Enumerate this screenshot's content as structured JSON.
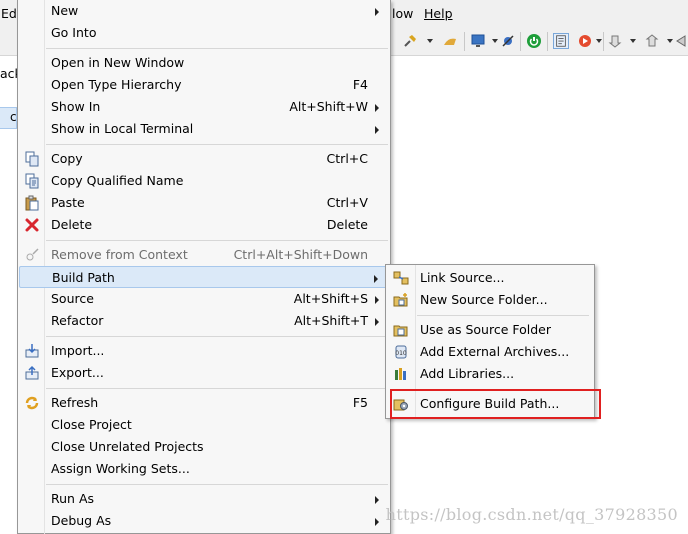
{
  "menubar": {
    "left_fragment": "Ed",
    "window_fragment": "low",
    "help": "Help"
  },
  "left_fragments": [
    "ack",
    "c"
  ],
  "context_menu": {
    "items": [
      {
        "label": "New",
        "accel": "",
        "submenu": true,
        "icon": "",
        "disabled": false
      },
      {
        "label": "Go Into",
        "accel": "",
        "submenu": false,
        "icon": "",
        "disabled": false
      },
      {
        "label": "Open in New Window",
        "accel": "",
        "submenu": false,
        "icon": "",
        "disabled": false
      },
      {
        "label": "Open Type Hierarchy",
        "accel": "F4",
        "submenu": false,
        "icon": "",
        "disabled": false
      },
      {
        "label": "Show In",
        "accel": "Alt+Shift+W",
        "submenu": true,
        "icon": "",
        "disabled": false
      },
      {
        "label": "Show in Local Terminal",
        "accel": "",
        "submenu": true,
        "icon": "",
        "disabled": false
      },
      {
        "label": "Copy",
        "accel": "Ctrl+C",
        "submenu": false,
        "icon": "copy-icon",
        "disabled": false
      },
      {
        "label": "Copy Qualified Name",
        "accel": "",
        "submenu": false,
        "icon": "copy-qualified-icon",
        "disabled": false
      },
      {
        "label": "Paste",
        "accel": "Ctrl+V",
        "submenu": false,
        "icon": "paste-icon",
        "disabled": false
      },
      {
        "label": "Delete",
        "accel": "Delete",
        "submenu": false,
        "icon": "delete-icon",
        "disabled": false
      },
      {
        "label": "Remove from Context",
        "accel": "Ctrl+Alt+Shift+Down",
        "submenu": false,
        "icon": "remove-context-icon",
        "disabled": true
      },
      {
        "label": "Build Path",
        "accel": "",
        "submenu": true,
        "icon": "",
        "disabled": false
      },
      {
        "label": "Source",
        "accel": "Alt+Shift+S",
        "submenu": true,
        "icon": "",
        "disabled": false
      },
      {
        "label": "Refactor",
        "accel": "Alt+Shift+T",
        "submenu": true,
        "icon": "",
        "disabled": false
      },
      {
        "label": "Import...",
        "accel": "",
        "submenu": false,
        "icon": "import-icon",
        "disabled": false
      },
      {
        "label": "Export...",
        "accel": "",
        "submenu": false,
        "icon": "export-icon",
        "disabled": false
      },
      {
        "label": "Refresh",
        "accel": "F5",
        "submenu": false,
        "icon": "refresh-icon",
        "disabled": false
      },
      {
        "label": "Close Project",
        "accel": "",
        "submenu": false,
        "icon": "",
        "disabled": false
      },
      {
        "label": "Close Unrelated Projects",
        "accel": "",
        "submenu": false,
        "icon": "",
        "disabled": false
      },
      {
        "label": "Assign Working Sets...",
        "accel": "",
        "submenu": false,
        "icon": "",
        "disabled": false
      },
      {
        "label": "Run As",
        "accel": "",
        "submenu": true,
        "icon": "",
        "disabled": false
      },
      {
        "label": "Debug As",
        "accel": "",
        "submenu": true,
        "icon": "",
        "disabled": false
      }
    ]
  },
  "build_path_submenu": {
    "items": [
      {
        "label": "Link Source...",
        "icon": "link-source-icon"
      },
      {
        "label": "New Source Folder...",
        "icon": "new-source-folder-icon"
      },
      {
        "label": "Use as Source Folder",
        "icon": "use-source-folder-icon"
      },
      {
        "label": "Add External Archives...",
        "icon": "jar-archive-icon"
      },
      {
        "label": "Add Libraries...",
        "icon": "libraries-icon"
      },
      {
        "label": "Configure Build Path...",
        "icon": "configure-build-path-icon"
      }
    ]
  },
  "watermark": "https://blog.csdn.net/qq_37928350",
  "colors": {
    "highlight": "#dbe9f8",
    "highlight_border": "#a8c8ec",
    "annotation_red": "#e02020"
  }
}
